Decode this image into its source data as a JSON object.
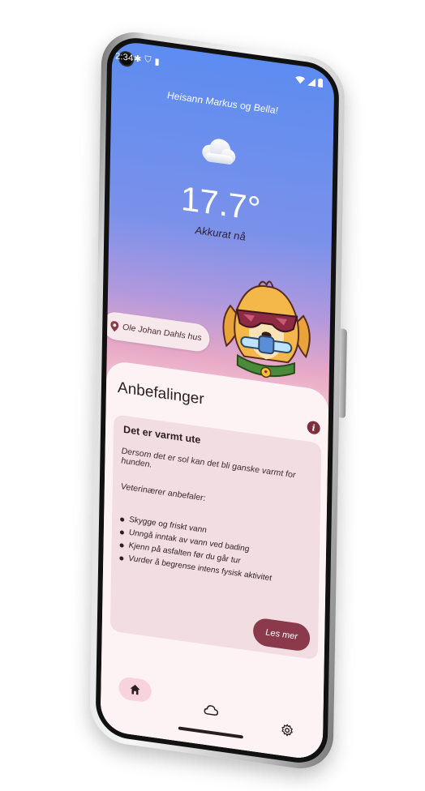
{
  "status_bar": {
    "time": "2:34"
  },
  "header": {
    "greeting": "Heisann Markus og Bella!"
  },
  "weather": {
    "icon": "cloud-icon",
    "temperature": "17.7°",
    "time_label": "Akkurat nå"
  },
  "location": {
    "label": "Ole Johan Dahls hus"
  },
  "recommendations": {
    "title": "Anbefalinger",
    "card": {
      "title": "Det er varmt ute",
      "description": "Dersom det er sol kan det bli ganske varmt for hunden.",
      "vet_label": "Veterinærer anbefaler:",
      "items": [
        "Skygge og friskt vann",
        "Unngå inntak av vann ved bading",
        "Kjenn på asfalten før du går tur",
        "Vurder å begrense intens fysisk aktivitet"
      ],
      "read_more_label": "Les mer"
    }
  },
  "nav": {
    "items": [
      "home",
      "weather",
      "settings"
    ]
  },
  "colors": {
    "accent": "#8a3a4a",
    "surface": "#fdf3f5",
    "card": "#f2dde2"
  }
}
